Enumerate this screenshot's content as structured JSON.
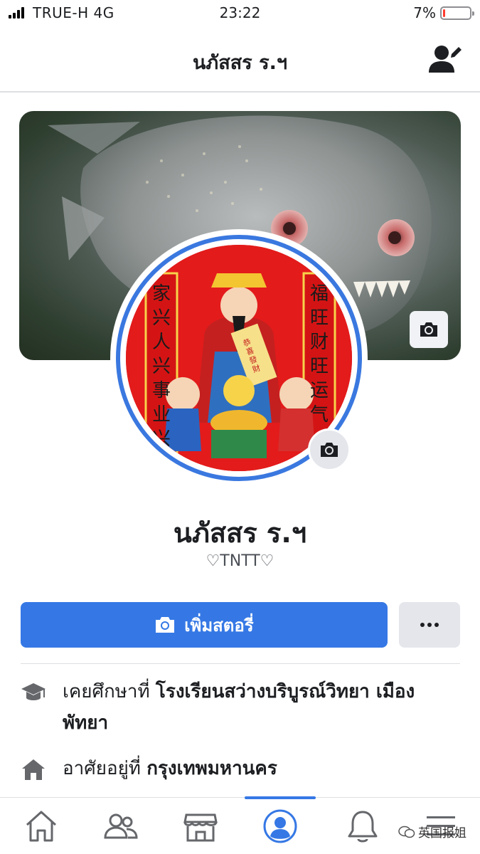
{
  "status_bar": {
    "carrier": "TRUE-H 4G",
    "time": "23:22",
    "battery_percent": "7%",
    "battery_level": 0.07,
    "signal_bars": 4
  },
  "header": {
    "title": "นภัสสร ร.ฯ",
    "edit_icon": "edit-user-icon"
  },
  "profile": {
    "name": "นภัสสร ร.ฯ",
    "nickname": "♡TNTT♡",
    "avatar_couplet_left": "家兴人兴事业兴",
    "avatar_couplet_right": "福旺财旺运气",
    "avatar_scroll_text": "恭喜發財"
  },
  "actions": {
    "add_story_label": "เพิ่มสตอรี่",
    "more_label": "..."
  },
  "info": {
    "education": {
      "prefix": "เคยศึกษาที่ ",
      "value": "โรงเรียนสว่างบริบูรณ์วิทยา เมือง พัทยา",
      "icon": "graduation-cap-icon"
    },
    "residence": {
      "prefix": "อาศัยอยู่ที่ ",
      "value": "กรุงเทพมหานคร",
      "icon": "home-icon"
    }
  },
  "bottom_nav": {
    "items": [
      "home-icon",
      "friends-icon",
      "marketplace-icon",
      "profile-icon",
      "notifications-icon",
      "menu-icon"
    ],
    "active": "profile-icon"
  },
  "watermark": "英国报姐",
  "colors": {
    "accent": "#3578e5",
    "avatar_ring": "#3a78e0",
    "battery_low": "#ff3b30"
  }
}
